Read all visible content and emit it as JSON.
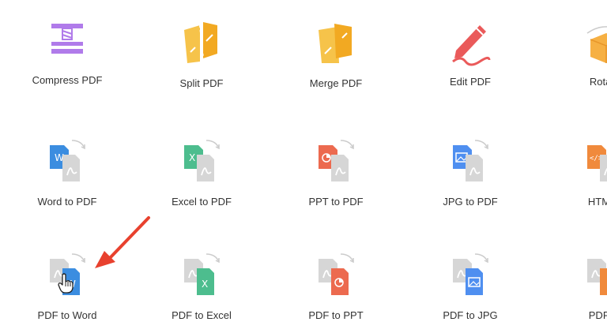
{
  "tools_row1": [
    {
      "label": "Compress PDF",
      "icon": "compress-icon"
    },
    {
      "label": "Split PDF",
      "icon": "split-icon"
    },
    {
      "label": "Merge PDF",
      "icon": "merge-icon"
    },
    {
      "label": "Edit PDF",
      "icon": "edit-pencil-icon"
    },
    {
      "label": "Rotate",
      "icon": "rotate-box-icon"
    }
  ],
  "tools_row2": [
    {
      "label": "Word to PDF",
      "icon": "word-to-pdf-icon"
    },
    {
      "label": "Excel to PDF",
      "icon": "excel-to-pdf-icon"
    },
    {
      "label": "PPT to PDF",
      "icon": "ppt-to-pdf-icon"
    },
    {
      "label": "JPG to PDF",
      "icon": "jpg-to-pdf-icon"
    },
    {
      "label": "HTML t",
      "icon": "html-to-pdf-icon"
    }
  ],
  "tools_row3": [
    {
      "label": "PDF to Word",
      "icon": "pdf-to-word-icon"
    },
    {
      "label": "PDF to Excel",
      "icon": "pdf-to-excel-icon"
    },
    {
      "label": "PDF to PPT",
      "icon": "pdf-to-ppt-icon"
    },
    {
      "label": "PDF to JPG",
      "icon": "pdf-to-jpg-icon"
    },
    {
      "label": "PDF to",
      "icon": "pdf-to-html-icon"
    }
  ],
  "colors": {
    "word": "#3b8de0",
    "excel": "#4dbd8e",
    "ppt": "#ec6a4f",
    "jpg": "#4f8ff0",
    "html": "#f08a3c",
    "pdf_gray": "#d6d6d6",
    "compress": "#b07bea",
    "split": "#f6b82b",
    "edit": "#ea5a5a",
    "annotation_arrow": "#e8412e"
  }
}
